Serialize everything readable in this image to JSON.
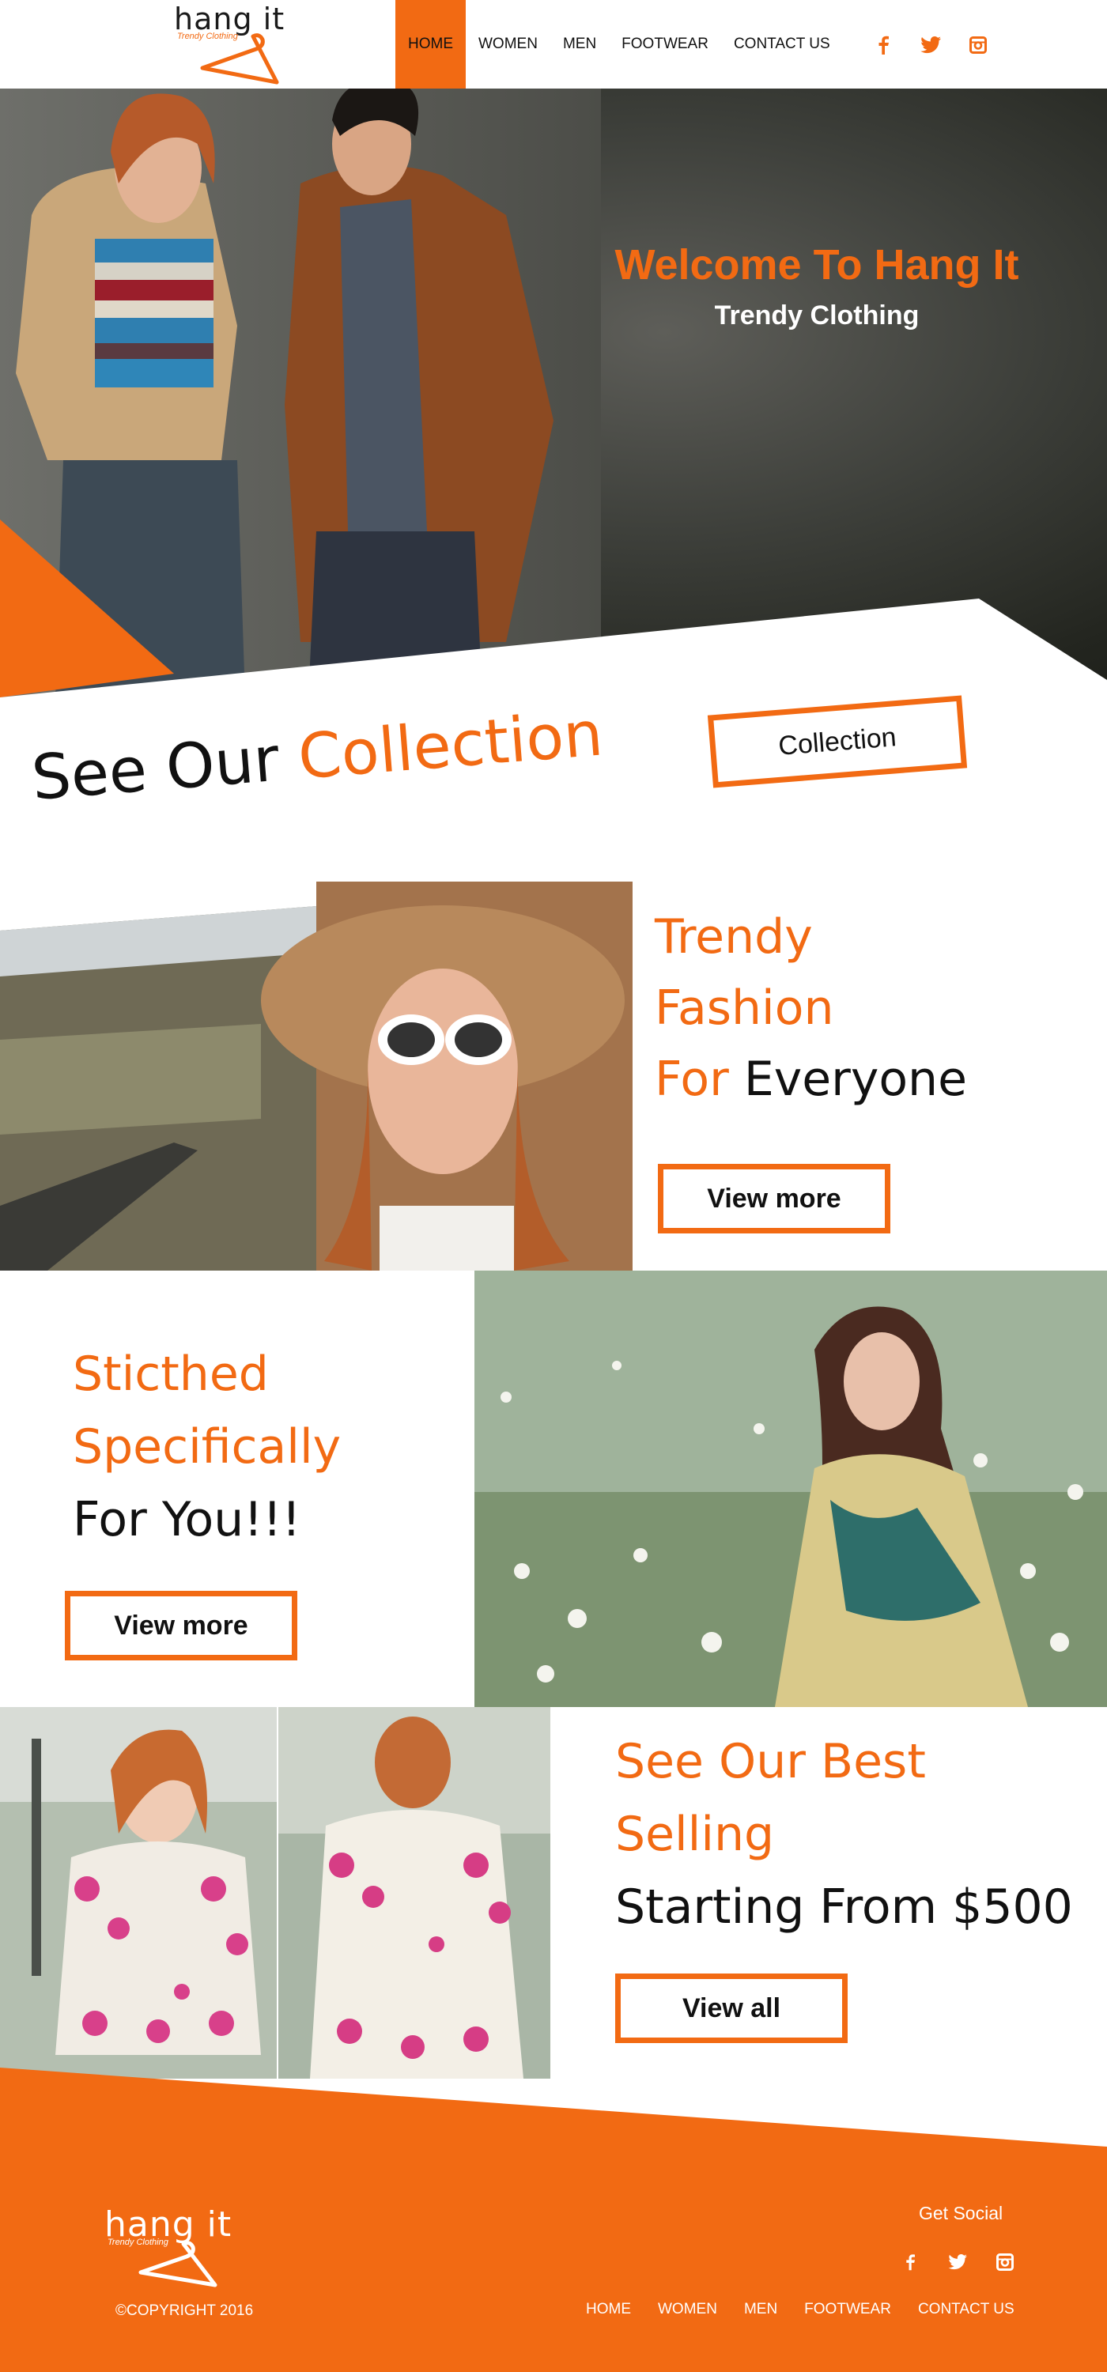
{
  "brand": {
    "name": "hang it",
    "tagline": "Trendy Clothing"
  },
  "nav": {
    "items": [
      {
        "label": "HOME",
        "active": true
      },
      {
        "label": "WOMEN",
        "active": false
      },
      {
        "label": "MEN",
        "active": false
      },
      {
        "label": "FOOTWEAR",
        "active": false
      },
      {
        "label": "CONTACT US",
        "active": false
      }
    ],
    "social": [
      "facebook-icon",
      "twitter-icon",
      "instagram-icon"
    ]
  },
  "hero": {
    "title": "Welcome To Hang It",
    "subtitle": "Trendy Clothing"
  },
  "collection": {
    "heading_dark": "See Our",
    "heading_accent": "Collection",
    "button_label": "Collection"
  },
  "feature1": {
    "line1": "Trendy",
    "line2": "Fashion",
    "line3_accent": "For",
    "line3_dark": "Everyone",
    "button_label": "View more"
  },
  "feature2": {
    "line1": "Sticthed",
    "line2": "Specifically",
    "line3": "For You!!!",
    "button_label": "View more"
  },
  "feature3": {
    "line1": "See Our Best",
    "line2": "Selling",
    "line3": "Starting From $500",
    "button_label": "View all"
  },
  "footer": {
    "copyright": "©COPYRIGHT 2016",
    "get_social": "Get Social",
    "social": [
      "facebook-icon",
      "twitter-icon",
      "instagram-icon"
    ],
    "nav": [
      "HOME",
      "WOMEN",
      "MEN",
      "FOOTWEAR",
      "CONTACT US"
    ]
  },
  "colors": {
    "accent": "#f26a13",
    "hero_dark": "#23251f",
    "text": "#111111",
    "background": "#ffffff"
  }
}
